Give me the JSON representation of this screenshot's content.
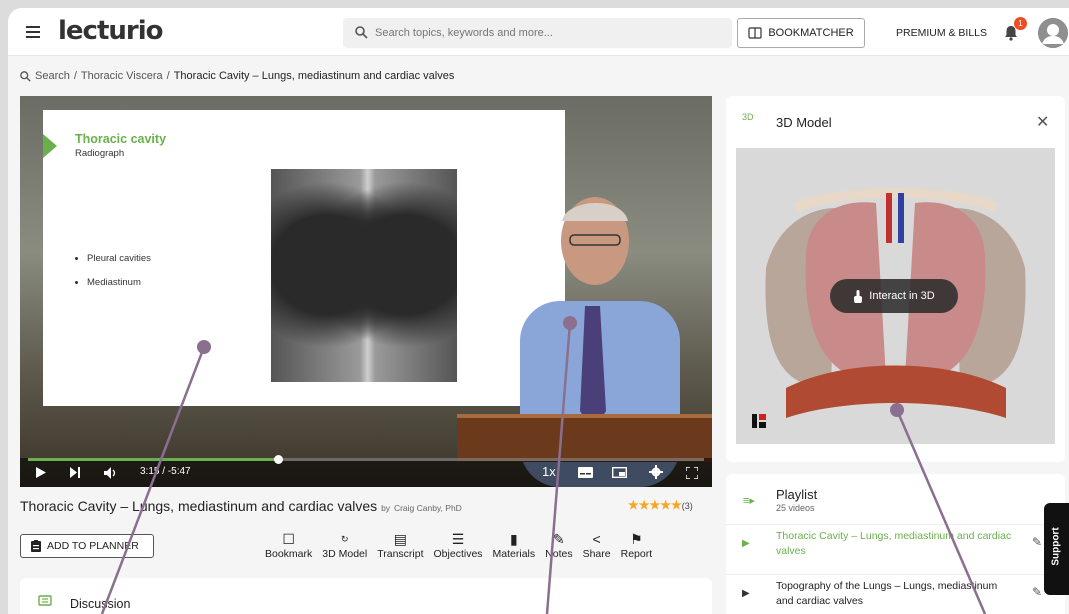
{
  "header": {
    "logo": "lecturio",
    "search_placeholder": "Search topics, keywords and more...",
    "bookmatcher_label": "BOOKMATCHER",
    "premium_label": "PREMIUM & BILLS",
    "notification_count": "1"
  },
  "breadcrumb": {
    "items": [
      "Search",
      "Thoracic Viscera",
      "Thoracic Cavity – Lungs, mediastinum and cardiac valves"
    ],
    "separator": "/"
  },
  "video": {
    "slide_title": "Thoracic cavity",
    "slide_subtitle": "Radiograph",
    "slide_bullets": [
      "Pleural cavities",
      "Mediastinum"
    ],
    "time_elapsed": "3:15",
    "time_remaining": "-5:47",
    "time_separator": "/",
    "speed": "1x",
    "progress_fraction": 0.37,
    "buffered_fraction": 0.4
  },
  "lecture": {
    "title": "Thoracic Cavity – Lungs, mediastinum and cardiac valves",
    "by_prefix": "by",
    "author": "Craig Canby, PhD",
    "rating_stars": "★★★★★",
    "rating_count": "(3)"
  },
  "actions": {
    "planner_label": "ADD TO PLANNER",
    "items": [
      "Bookmark",
      "3D Model",
      "Transcript",
      "Objectives",
      "Materials",
      "Notes",
      "Share",
      "Report"
    ]
  },
  "discussion": {
    "label": "Discussion"
  },
  "model3d": {
    "title": "3D Model",
    "icon_text": "3D",
    "interact_label": "Interact in 3D"
  },
  "playlist": {
    "title": "Playlist",
    "count": "25 videos",
    "items": [
      {
        "title": "Thoracic Cavity – Lungs, mediastinum and cardiac valves",
        "active": true
      },
      {
        "title": "Topography of the Lungs – Lungs, mediastinum and cardiac valves",
        "active": false
      }
    ]
  },
  "support": {
    "label": "Support"
  },
  "colors": {
    "accent": "#6ab04c",
    "badge": "#f04c23",
    "stars": "#f5a623",
    "annotation": "#8a6f8f"
  }
}
